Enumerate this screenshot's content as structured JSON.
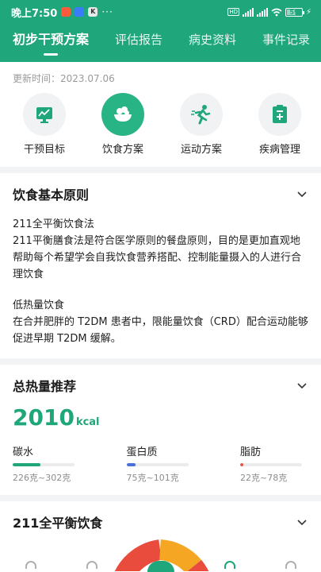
{
  "status": {
    "time": "晚上7:50",
    "battery": "59"
  },
  "tabs": [
    {
      "label": "初步干预方案",
      "active": true
    },
    {
      "label": "评估报告"
    },
    {
      "label": "病史资料"
    },
    {
      "label": "事件记录"
    }
  ],
  "updated": "更新时间：2023.07.06",
  "quick": [
    {
      "label": "干预目标",
      "icon": "target-chart-icon"
    },
    {
      "label": "饮食方案",
      "icon": "food-bowl-icon",
      "active": true
    },
    {
      "label": "运动方案",
      "icon": "running-icon"
    },
    {
      "label": "疾病管理",
      "icon": "clipboard-plus-icon"
    }
  ],
  "principle": {
    "title": "饮食基本原则",
    "p1_title": "211全平衡饮食法",
    "p1_body": "211平衡膳食法是符合医学原则的餐盘原则，目的是更加直观地帮助每个希望学会自我饮食营养搭配、控制能量摄入的人进行合理饮食",
    "p2_title": "低热量饮食",
    "p2_body": "在合并肥胖的 T2DM 患者中，限能量饮食（CRD）配合运动能够促进早期 T2DM 缓解。"
  },
  "energy": {
    "title": "总热量推荐",
    "value": "2010",
    "unit": "kcal",
    "macros": [
      {
        "name": "碳水",
        "range": "226克~302克",
        "color": "#1fa67a",
        "fill": 0.45
      },
      {
        "name": "蛋白质",
        "range": "75克~101克",
        "color": "#4a6fd6",
        "fill": 0.15
      },
      {
        "name": "脂肪",
        "range": "22克~78克",
        "color": "#e6534a",
        "fill": 0.05
      }
    ]
  },
  "plate": {
    "title": "211全平衡饮食"
  },
  "colors": {
    "primary": "#1fa67a"
  }
}
